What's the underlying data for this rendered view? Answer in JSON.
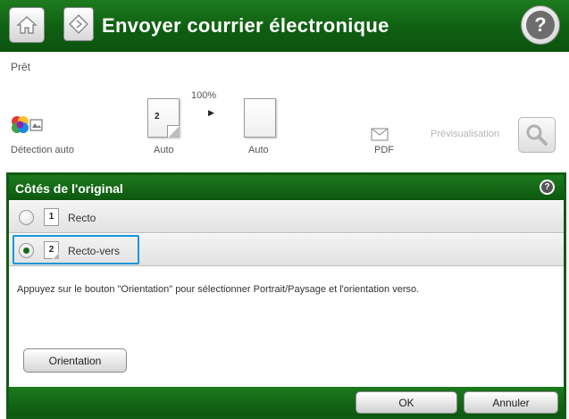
{
  "header": {
    "title": "Envoyer courrier électronique",
    "help_glyph": "?",
    "icons": [
      "home-icon",
      "email-app-icon",
      "help-icon"
    ]
  },
  "status": {
    "text": "Prêt"
  },
  "settings": {
    "color_label": "Détection auto",
    "duplex_label": "Auto",
    "duplex_page_number": "2",
    "zoom_value": "100%",
    "size_label": "Auto",
    "file_type_label": "PDF",
    "preview_label": "Prévisualisation"
  },
  "dialog": {
    "title": "Côtés de l'original",
    "help_glyph": "?",
    "options": [
      {
        "number": "1",
        "label": "Recto",
        "selected": false
      },
      {
        "number": "2",
        "label": "Recto-vers",
        "selected": true
      }
    ],
    "info_text": "Appuyez sur le bouton \"Orientation\" pour sélectionner Portrait/Paysage et l'orientation verso.",
    "orientation_button": "Orientation",
    "ok_button": "OK",
    "cancel_button": "Annuler"
  },
  "colors": {
    "header_green": "#0f5f12",
    "selection_blue": "#1a97d8",
    "radio_selected": "#17691a"
  }
}
